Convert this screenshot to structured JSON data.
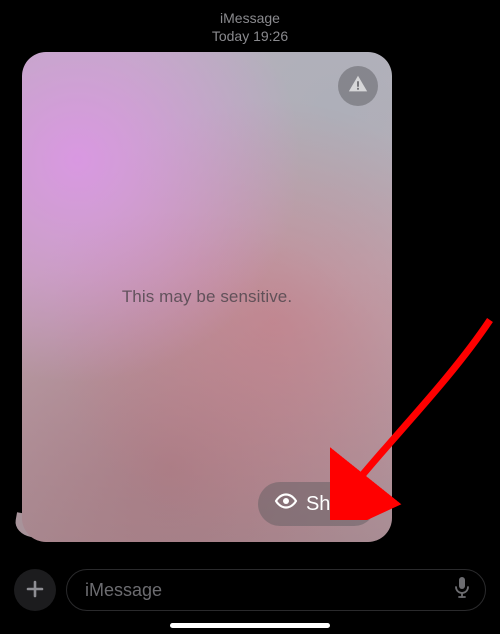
{
  "header": {
    "service": "iMessage",
    "timestamp": "Today 19:26"
  },
  "bubble": {
    "sensitive_label": "This may be sensitive.",
    "show_label": "Show"
  },
  "compose": {
    "placeholder": "iMessage"
  }
}
